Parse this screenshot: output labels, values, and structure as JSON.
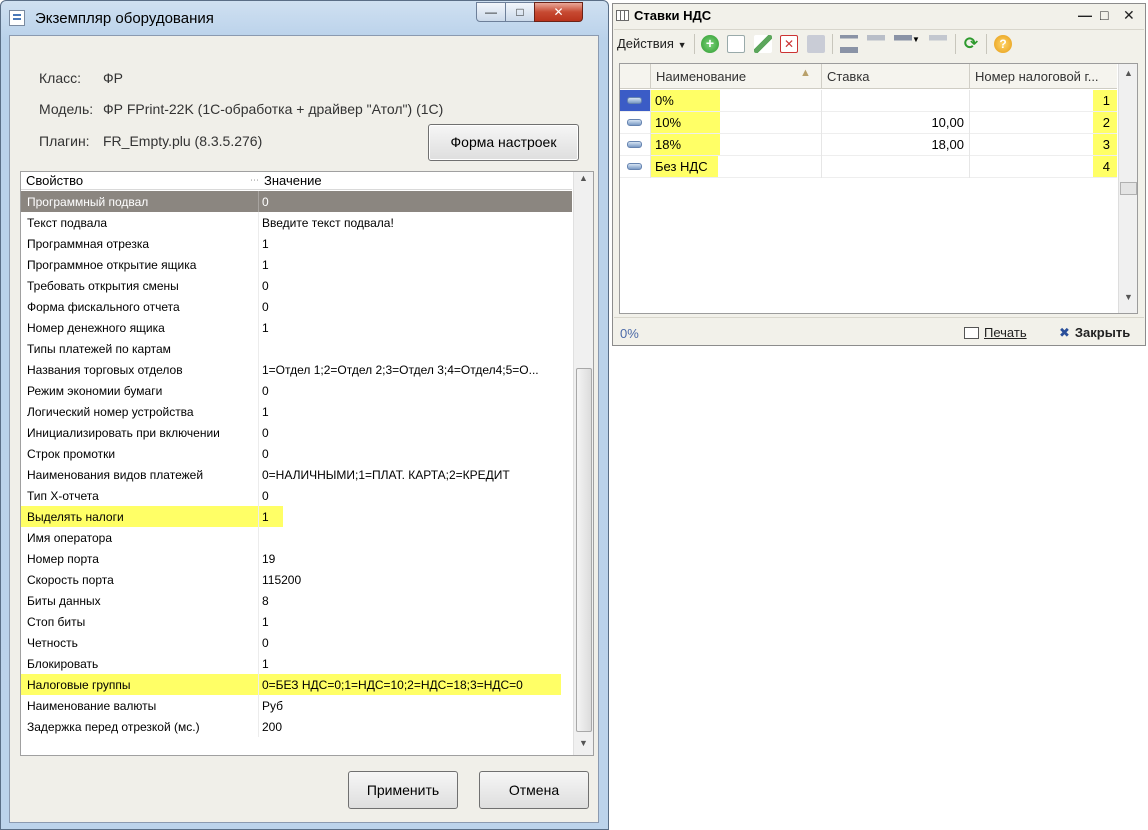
{
  "equipment_window": {
    "title": "Экземпляр оборудования",
    "class_label": "Класс:",
    "class_value": "ФР",
    "model_label": "Модель:",
    "model_value": "ФР FPrint-22K (1С-обработка + драйвер \"Атол\") (1С)",
    "plugin_label": "Плагин:",
    "plugin_value": "FR_Empty.plu (8.3.5.276)",
    "settings_button": "Форма настроек",
    "grid": {
      "col_property": "Свойство",
      "col_value": "Значение",
      "rows": [
        {
          "name": "Программный подвал",
          "value": "0",
          "selected": true
        },
        {
          "name": "Текст подвала",
          "value": "Введите текст подвала!"
        },
        {
          "name": "Программная отрезка",
          "value": "1"
        },
        {
          "name": "Программное открытие ящика",
          "value": "1"
        },
        {
          "name": "Требовать открытия смены",
          "value": "0"
        },
        {
          "name": "Форма фискального отчета",
          "value": "0"
        },
        {
          "name": "Номер денежного ящика",
          "value": "1"
        },
        {
          "name": "Типы платежей по картам",
          "value": ""
        },
        {
          "name": "Названия торговых отделов",
          "value": "1=Отдел 1;2=Отдел 2;3=Отдел 3;4=Отдел4;5=О..."
        },
        {
          "name": "Режим экономии бумаги",
          "value": "0"
        },
        {
          "name": "Логический номер устройства",
          "value": "1"
        },
        {
          "name": "Инициализировать при включении",
          "value": "0"
        },
        {
          "name": "Строк промотки",
          "value": "0"
        },
        {
          "name": "Наименования видов платежей",
          "value": "0=НАЛИЧНЫМИ;1=ПЛАТ. КАРТА;2=КРЕДИТ"
        },
        {
          "name": "Тип Х-отчета",
          "value": "0"
        },
        {
          "name": "Выделять налоги",
          "value": "1",
          "highlight": true
        },
        {
          "name": "Имя оператора",
          "value": ""
        },
        {
          "name": "Номер порта",
          "value": "19"
        },
        {
          "name": "Скорость порта",
          "value": "115200"
        },
        {
          "name": "Биты данных",
          "value": "8"
        },
        {
          "name": "Стоп биты",
          "value": "1"
        },
        {
          "name": "Четность",
          "value": "0"
        },
        {
          "name": "Блокировать",
          "value": "1"
        },
        {
          "name": "Налоговые группы",
          "value": "0=БЕЗ НДС=0;1=НДС=10;2=НДС=18;3=НДС=0",
          "highlight": true
        },
        {
          "name": "Наименование валюты",
          "value": "Руб"
        },
        {
          "name": "Задержка перед отрезкой (мс.)",
          "value": "200"
        }
      ]
    },
    "apply_button": "Применить",
    "cancel_button": "Отмена"
  },
  "vat_window": {
    "title": "Ставки НДС",
    "actions_label": "Действия",
    "columns": [
      "Наименование",
      "Ставка",
      "Номер налоговой г..."
    ],
    "rows": [
      {
        "name": "0%",
        "rate": "",
        "group": "1",
        "current": true
      },
      {
        "name": "10%",
        "rate": "10,00",
        "group": "2"
      },
      {
        "name": "18%",
        "rate": "18,00",
        "group": "3"
      },
      {
        "name": "Без НДС",
        "rate": "",
        "group": "4"
      }
    ],
    "status_value": "0%",
    "print_button": "Печать",
    "close_button": "Закрыть"
  },
  "colors": {
    "highlight": "#ffff66",
    "selected_row": "#8b8680",
    "current_marker": "#3b5cc6"
  }
}
